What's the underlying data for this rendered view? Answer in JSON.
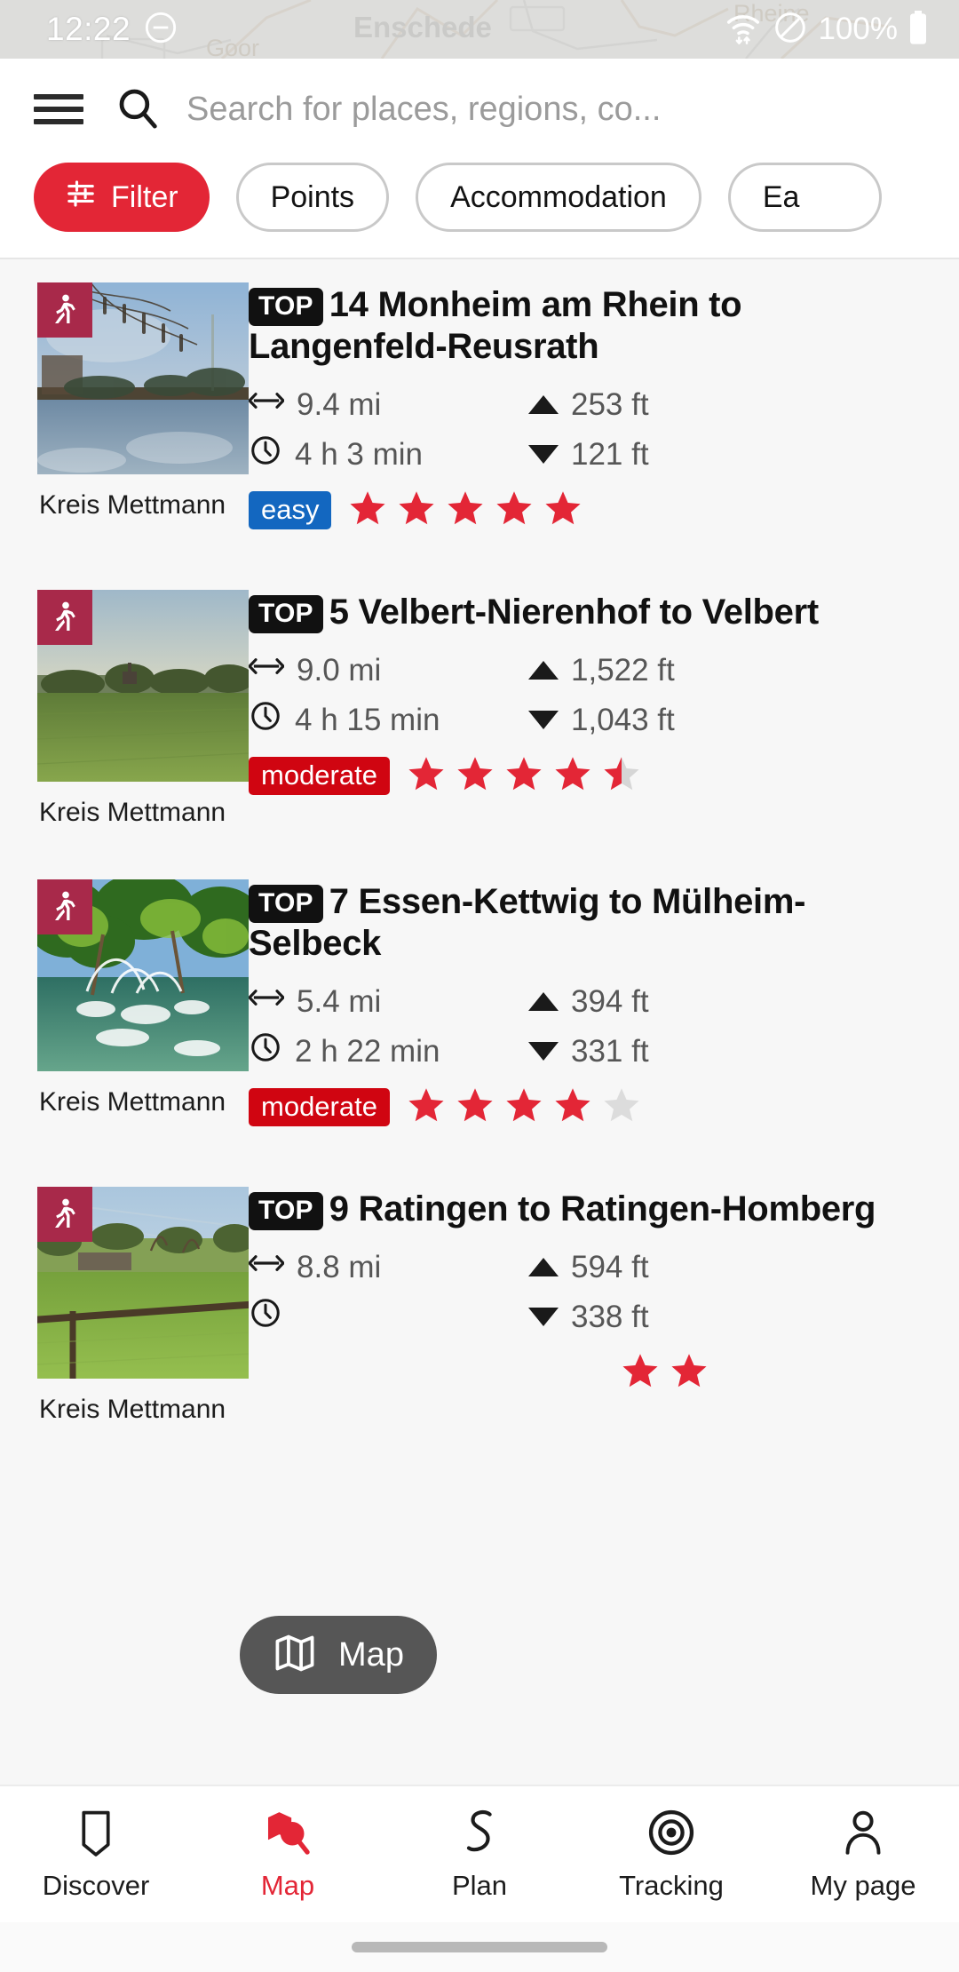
{
  "status_bar": {
    "time": "12:22",
    "dnd_icon": "do-not-disturb-icon",
    "wifi_icon": "wifi-icon",
    "blocked_icon": "no-sim-icon",
    "battery_text": "100%",
    "battery_icon": "battery-full-icon",
    "map_labels": [
      "Enschede",
      "Goor",
      "Rheine"
    ]
  },
  "header": {
    "menu_icon": "hamburger-menu-icon",
    "search_icon": "search-icon",
    "search_value": "",
    "search_placeholder": "Search for places, regions, co..."
  },
  "filters": {
    "accent_color": "#e32636",
    "chips": [
      {
        "label": "Filter",
        "icon": "sliders-icon",
        "active": true
      },
      {
        "label": "Points",
        "icon": "",
        "active": false
      },
      {
        "label": "Accommodation",
        "icon": "",
        "active": false
      },
      {
        "label": "Ea",
        "icon": "",
        "active": false
      }
    ]
  },
  "tours": [
    {
      "badge": "TOP",
      "title": "14 Monheim am Rhein to Langenfeld-Reusrath",
      "region": "Kreis Mettmann",
      "distance": "9.4 mi",
      "duration": "4 h 3 min",
      "ascent": "253 ft",
      "descent": "121 ft",
      "difficulty": "easy",
      "difficulty_color": "#1367c0",
      "stars_full": 5,
      "stars_half": 0,
      "stars_empty": 0,
      "activity_icon": "hiking-icon"
    },
    {
      "badge": "TOP",
      "title": "5 Velbert-Nierenhof to Velbert",
      "region": "Kreis Mettmann",
      "distance": "9.0 mi",
      "duration": "4 h 15 min",
      "ascent": "1,522 ft",
      "descent": "1,043 ft",
      "difficulty": "moderate",
      "difficulty_color": "#d00511",
      "stars_full": 4,
      "stars_half": 1,
      "stars_empty": 0,
      "activity_icon": "hiking-icon"
    },
    {
      "badge": "TOP",
      "title": "7 Essen-Kettwig to Mülheim-Selbeck",
      "region": "Kreis Mettmann",
      "distance": "5.4 mi",
      "duration": "2 h 22 min",
      "ascent": "394 ft",
      "descent": "331 ft",
      "difficulty": "moderate",
      "difficulty_color": "#d00511",
      "stars_full": 4,
      "stars_half": 0,
      "stars_empty": 1,
      "activity_icon": "hiking-icon"
    },
    {
      "badge": "TOP",
      "title": "9 Ratingen to Ratingen-Homberg",
      "region": "Kreis Mettmann",
      "distance": "8.8 mi",
      "duration": "",
      "ascent": "594 ft",
      "descent": "338 ft",
      "difficulty": "",
      "difficulty_color": "#d00511",
      "stars_full": 2,
      "stars_half": 0,
      "stars_empty": 0,
      "activity_icon": "hiking-icon"
    }
  ],
  "labels": {
    "distance_icon": "distance-arrows-icon",
    "duration_icon": "clock-icon",
    "ascent_icon": "ascent-triangle-up-icon",
    "descent_icon": "descent-triangle-down-icon"
  },
  "map_fab": {
    "label": "Map",
    "icon": "map-folded-icon"
  },
  "bottom_nav": {
    "active_color": "#e32636",
    "items": [
      {
        "label": "Discover",
        "icon": "tag-bookmark-icon",
        "active": false
      },
      {
        "label": "Map",
        "icon": "map-search-icon",
        "active": true
      },
      {
        "label": "Plan",
        "icon": "route-curve-icon",
        "active": false
      },
      {
        "label": "Tracking",
        "icon": "target-record-icon",
        "active": false
      },
      {
        "label": "My page",
        "icon": "person-icon",
        "active": false
      }
    ]
  }
}
